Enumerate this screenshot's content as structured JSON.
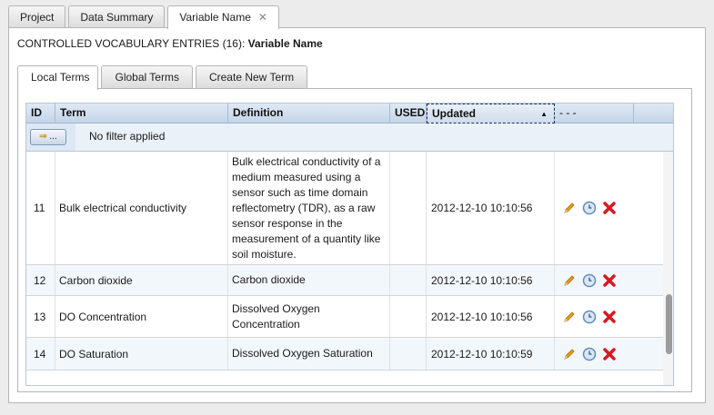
{
  "top_tabs": [
    {
      "label": "Project"
    },
    {
      "label": "Data Summary"
    },
    {
      "label": "Variable Name",
      "close": "✕"
    }
  ],
  "title": {
    "prefix": "CONTROLLED VOCABULARY ENTRIES (16):",
    "name": "Variable Name"
  },
  "inner_tabs": [
    {
      "label": "Local Terms"
    },
    {
      "label": "Global Terms"
    },
    {
      "label": "Create New Term"
    }
  ],
  "grid": {
    "columns": [
      {
        "label": "ID"
      },
      {
        "label": "Term"
      },
      {
        "label": "Definition"
      },
      {
        "label": "USED"
      },
      {
        "label": "Updated",
        "sort": "ascending",
        "sort_glyph": "▲"
      },
      {
        "label": "- - -"
      }
    ],
    "filter_button": {
      "arrow": "⇒",
      "dots": "..."
    },
    "filter_text": "No filter applied",
    "rows": [
      {
        "id": "11",
        "term": "Bulk electrical conductivity",
        "definition": "Bulk electrical conductivity of a medium measured using a sensor such as time domain reflectometry (TDR), as a raw sensor response in the measurement of a quantity like soil moisture.",
        "used": "",
        "updated": "2012-12-10 10:10:56"
      },
      {
        "id": "12",
        "term": "Carbon dioxide",
        "definition": "Carbon dioxide",
        "used": "",
        "updated": "2012-12-10 10:10:56"
      },
      {
        "id": "13",
        "term": "DO Concentration",
        "definition": "Dissolved Oxygen Concentration",
        "used": "",
        "updated": "2012-12-10 10:10:56"
      },
      {
        "id": "14",
        "term": "DO Saturation",
        "definition": "Dissolved Oxygen Saturation",
        "used": "",
        "updated": "2012-12-10 10:10:59"
      }
    ],
    "row_actions": [
      "edit-pencil-icon",
      "history-clock-icon",
      "delete-x-icon"
    ]
  },
  "colors": {
    "header": "#c4d5e8",
    "filter_bar": "#dde8f4",
    "delete": "#d71920",
    "edit": "#e8a317",
    "history": "#5f8bbd"
  }
}
